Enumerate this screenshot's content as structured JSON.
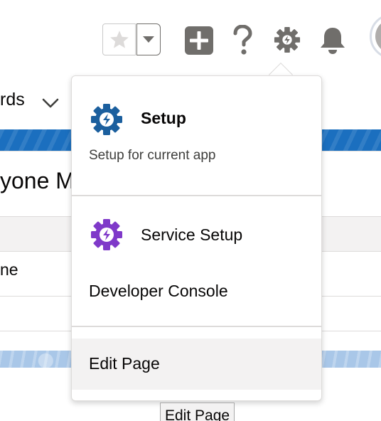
{
  "header": {
    "icons": {
      "favorite": "star-icon",
      "favorites_menu": "chevron-down-icon",
      "add": "plus-icon",
      "help": "question-mark-icon",
      "setup": "gear-icon",
      "notifications": "bell-icon"
    }
  },
  "background": {
    "nav_fragment": "rds",
    "page_title_fragment": "yone M",
    "table_cell_fragment": "ne"
  },
  "setup_menu": {
    "setup": {
      "title": "Setup",
      "subtitle": "Setup for current app",
      "icon": "gear-lightning-icon",
      "icon_color": "#1b5f9e"
    },
    "service_setup": {
      "title": "Service Setup",
      "icon": "gear-lightning-icon",
      "icon_color": "#7f39c9"
    },
    "developer_console": {
      "title": "Developer Console"
    },
    "edit_page": {
      "title": "Edit Page"
    }
  },
  "tooltip": {
    "text": "Edit Page"
  },
  "colors": {
    "banner_blue": "#1b6fbf",
    "setup_icon_blue": "#1b5f9e",
    "service_icon_purple": "#7f39c9",
    "icon_gray": "#706e6b",
    "hover_bg": "#f3f2f2"
  }
}
